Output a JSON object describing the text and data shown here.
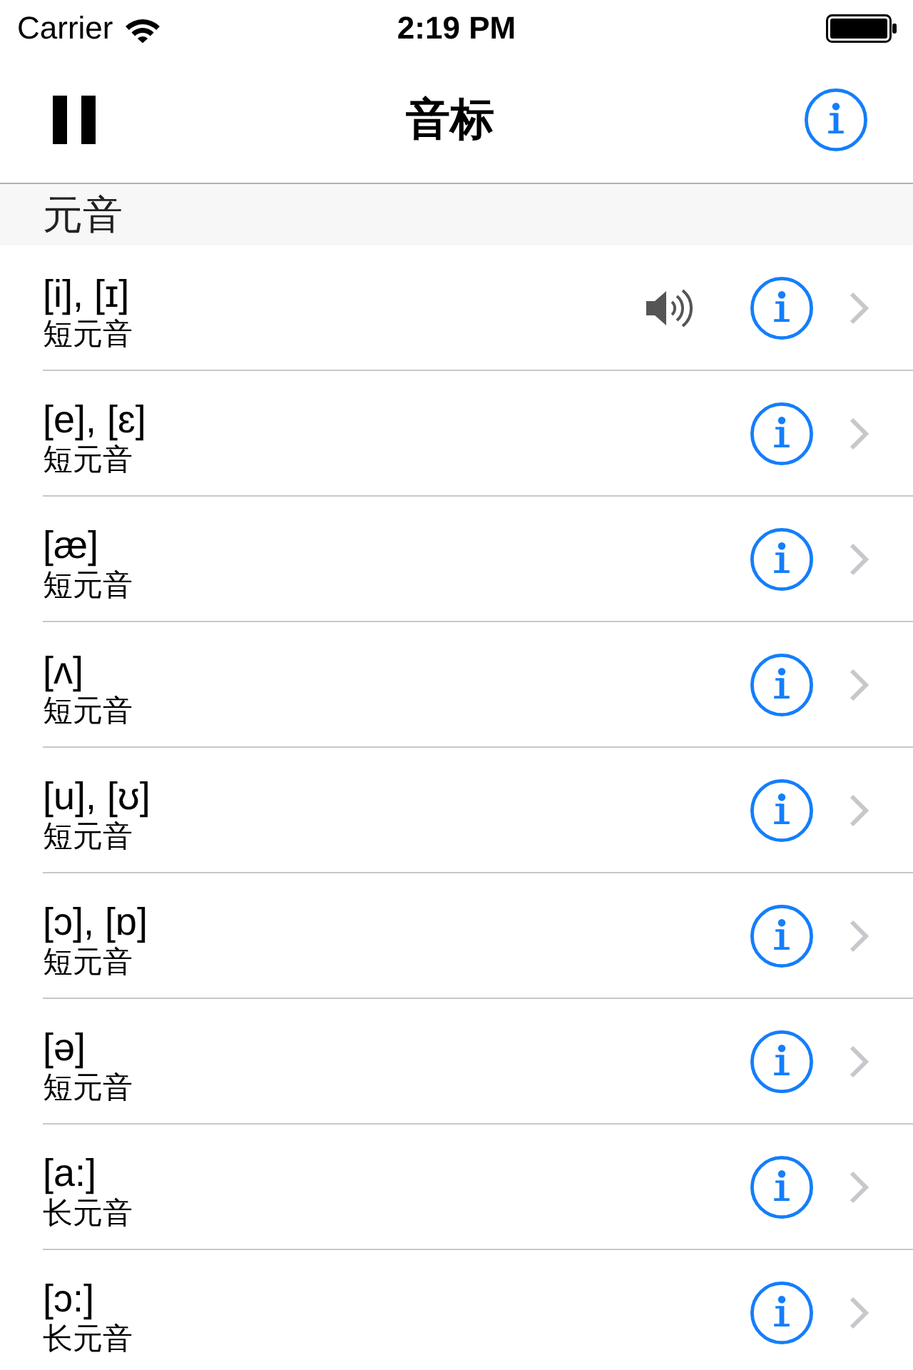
{
  "status_bar": {
    "carrier": "Carrier",
    "time": "2:19 PM"
  },
  "nav_bar": {
    "title": "音标"
  },
  "sections": [
    {
      "title": "元音",
      "rows": [
        {
          "symbol": "[i], [ɪ]",
          "category": "短元音",
          "playing": true
        },
        {
          "symbol": "[e], [ɛ]",
          "category": "短元音",
          "playing": false
        },
        {
          "symbol": "[æ]",
          "category": "短元音",
          "playing": false
        },
        {
          "symbol": "[ʌ]",
          "category": "短元音",
          "playing": false
        },
        {
          "symbol": "[u], [ʊ]",
          "category": "短元音",
          "playing": false
        },
        {
          "symbol": "[ɔ], [ɒ]",
          "category": "短元音",
          "playing": false
        },
        {
          "symbol": "[ə]",
          "category": "短元音",
          "playing": false
        },
        {
          "symbol": "[a:]",
          "category": "长元音",
          "playing": false
        },
        {
          "symbol": "[ɔ:]",
          "category": "长元音",
          "playing": false
        }
      ]
    }
  ]
}
